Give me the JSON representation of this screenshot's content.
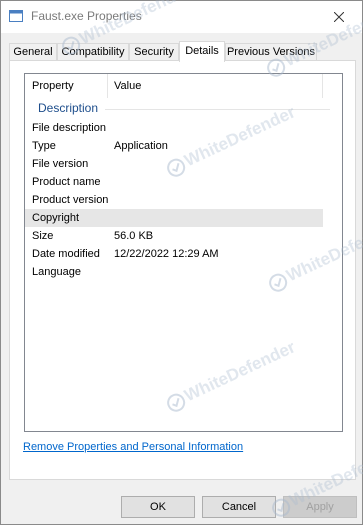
{
  "window": {
    "title": "Faust.exe Properties"
  },
  "tabs": [
    {
      "label": "General"
    },
    {
      "label": "Compatibility"
    },
    {
      "label": "Security"
    },
    {
      "label": "Details"
    },
    {
      "label": "Previous Versions"
    }
  ],
  "details": {
    "headers": {
      "property": "Property",
      "value": "Value"
    },
    "group": "Description",
    "rows": [
      {
        "property": "File description",
        "value": ""
      },
      {
        "property": "Type",
        "value": "Application"
      },
      {
        "property": "File version",
        "value": ""
      },
      {
        "property": "Product name",
        "value": ""
      },
      {
        "property": "Product version",
        "value": ""
      },
      {
        "property": "Copyright",
        "value": ""
      },
      {
        "property": "Size",
        "value": "56.0 KB"
      },
      {
        "property": "Date modified",
        "value": "12/22/2022 12:29 AM"
      },
      {
        "property": "Language",
        "value": ""
      }
    ]
  },
  "link": {
    "label": "Remove Properties and Personal Information"
  },
  "buttons": {
    "ok": "OK",
    "cancel": "Cancel",
    "apply": "Apply"
  },
  "watermark": {
    "text": "WhiteDefender"
  }
}
